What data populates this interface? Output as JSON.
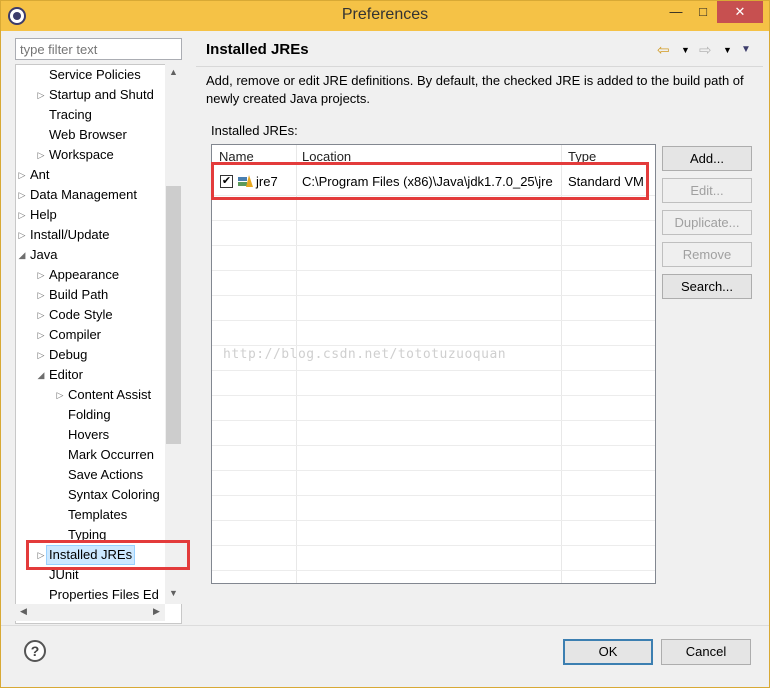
{
  "window": {
    "title": "Preferences",
    "min_label": "—",
    "max_label": "□",
    "close_label": "✕"
  },
  "sidebar": {
    "filter_placeholder": "type filter text",
    "items": [
      {
        "label": "Service Policies",
        "expand": ""
      },
      {
        "label": "Startup and Shutd",
        "expand": "▷"
      },
      {
        "label": "Tracing",
        "expand": ""
      },
      {
        "label": "Web Browser",
        "expand": ""
      },
      {
        "label": "Workspace",
        "expand": "▷"
      },
      {
        "label": "Ant",
        "expand": "▷"
      },
      {
        "label": "Data Management",
        "expand": "▷"
      },
      {
        "label": "Help",
        "expand": "▷"
      },
      {
        "label": "Install/Update",
        "expand": "▷"
      },
      {
        "label": "Java",
        "expand": "◢"
      },
      {
        "label": "Appearance",
        "expand": "▷"
      },
      {
        "label": "Build Path",
        "expand": "▷"
      },
      {
        "label": "Code Style",
        "expand": "▷"
      },
      {
        "label": "Compiler",
        "expand": "▷"
      },
      {
        "label": "Debug",
        "expand": "▷"
      },
      {
        "label": "Editor",
        "expand": "◢"
      },
      {
        "label": "Content Assist",
        "expand": "▷"
      },
      {
        "label": "Folding",
        "expand": ""
      },
      {
        "label": "Hovers",
        "expand": ""
      },
      {
        "label": "Mark Occurren",
        "expand": ""
      },
      {
        "label": "Save Actions",
        "expand": ""
      },
      {
        "label": "Syntax Coloring",
        "expand": ""
      },
      {
        "label": "Templates",
        "expand": ""
      },
      {
        "label": "Typing",
        "expand": ""
      },
      {
        "label": "Installed JREs",
        "expand": "▷"
      },
      {
        "label": "JUnit",
        "expand": ""
      },
      {
        "label": "Properties Files Ed",
        "expand": ""
      }
    ]
  },
  "main": {
    "title": "Installed JREs",
    "description": "Add, remove or edit JRE definitions. By default, the checked JRE is added to the build path of newly created Java projects.",
    "list_label": "Installed JREs:",
    "columns": [
      "Name",
      "Location",
      "Type"
    ],
    "rows": [
      {
        "checked": "✔",
        "name": "jre7",
        "location": "C:\\Program Files (x86)\\Java\\jdk1.7.0_25\\jre",
        "type": "Standard VM"
      }
    ],
    "buttons": {
      "add": "Add...",
      "edit": "Edit...",
      "duplicate": "Duplicate...",
      "remove": "Remove",
      "search": "Search..."
    },
    "watermark": "http://blog.csdn.net/tototuzuoquan"
  },
  "footer": {
    "help": "?",
    "ok": "OK",
    "cancel": "Cancel"
  },
  "colors": {
    "titlebar": "#f5c246",
    "highlight": "#e33b3b",
    "selected": "#cce8ff"
  }
}
